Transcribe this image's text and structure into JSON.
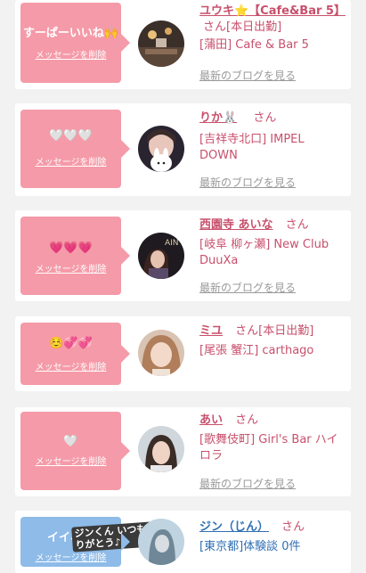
{
  "cards": [
    {
      "message": "すーぱーいいね🙌",
      "delete_label": "メッセージを削除",
      "name_prefix": "⭐",
      "name": "ユウキ⭐【Cafe&Bar 5】",
      "san": "さん",
      "status": "[本日出勤]",
      "shop": "[蒲田] Cafe & Bar 5",
      "blog_label": "最新のブログを見る"
    },
    {
      "message": "🤍🤍🤍",
      "delete_label": "メッセージを削除",
      "name": "りか🐰",
      "san": "さん",
      "shop": "[吉祥寺北口] IMPEL DOWN",
      "blog_label": "最新のブログを見る"
    },
    {
      "message": "💗💗💗",
      "delete_label": "メッセージを削除",
      "name": "西園寺 あいな",
      "san": "さん",
      "shop": "[岐阜 柳ヶ瀬] New Club DuuXa",
      "blog_label": "最新のブログを見る"
    },
    {
      "message": "☺️💞💞",
      "delete_label": "メッセージを削除",
      "name": "ミユ",
      "san": "さん",
      "status": "[本日出勤]",
      "shop": "[尾張 蟹江] carthago",
      "blog_label": "最新のブログを見る"
    },
    {
      "message": "🤍",
      "delete_label": "メッセージを削除",
      "name": "あい",
      "san": "さん",
      "shop": "[歌舞伎町] Girl's Bar ハイロラ",
      "blog_label": "最新のブログを見る"
    },
    {
      "message": "イイネ",
      "overlay_text": "ジンくん いつもありがとう♪",
      "delete_label": "メッセージを削除",
      "name": "ジン（じん）",
      "san": "さん",
      "shop": "[東京都]体験談 0件"
    }
  ],
  "colors": {
    "bubble_pink": "#f59aa8",
    "bubble_blue": "#8ebbe8",
    "name_pink": "#c8506c",
    "name_blue": "#2f6fb5",
    "blog_gray": "#9a9a9a"
  }
}
